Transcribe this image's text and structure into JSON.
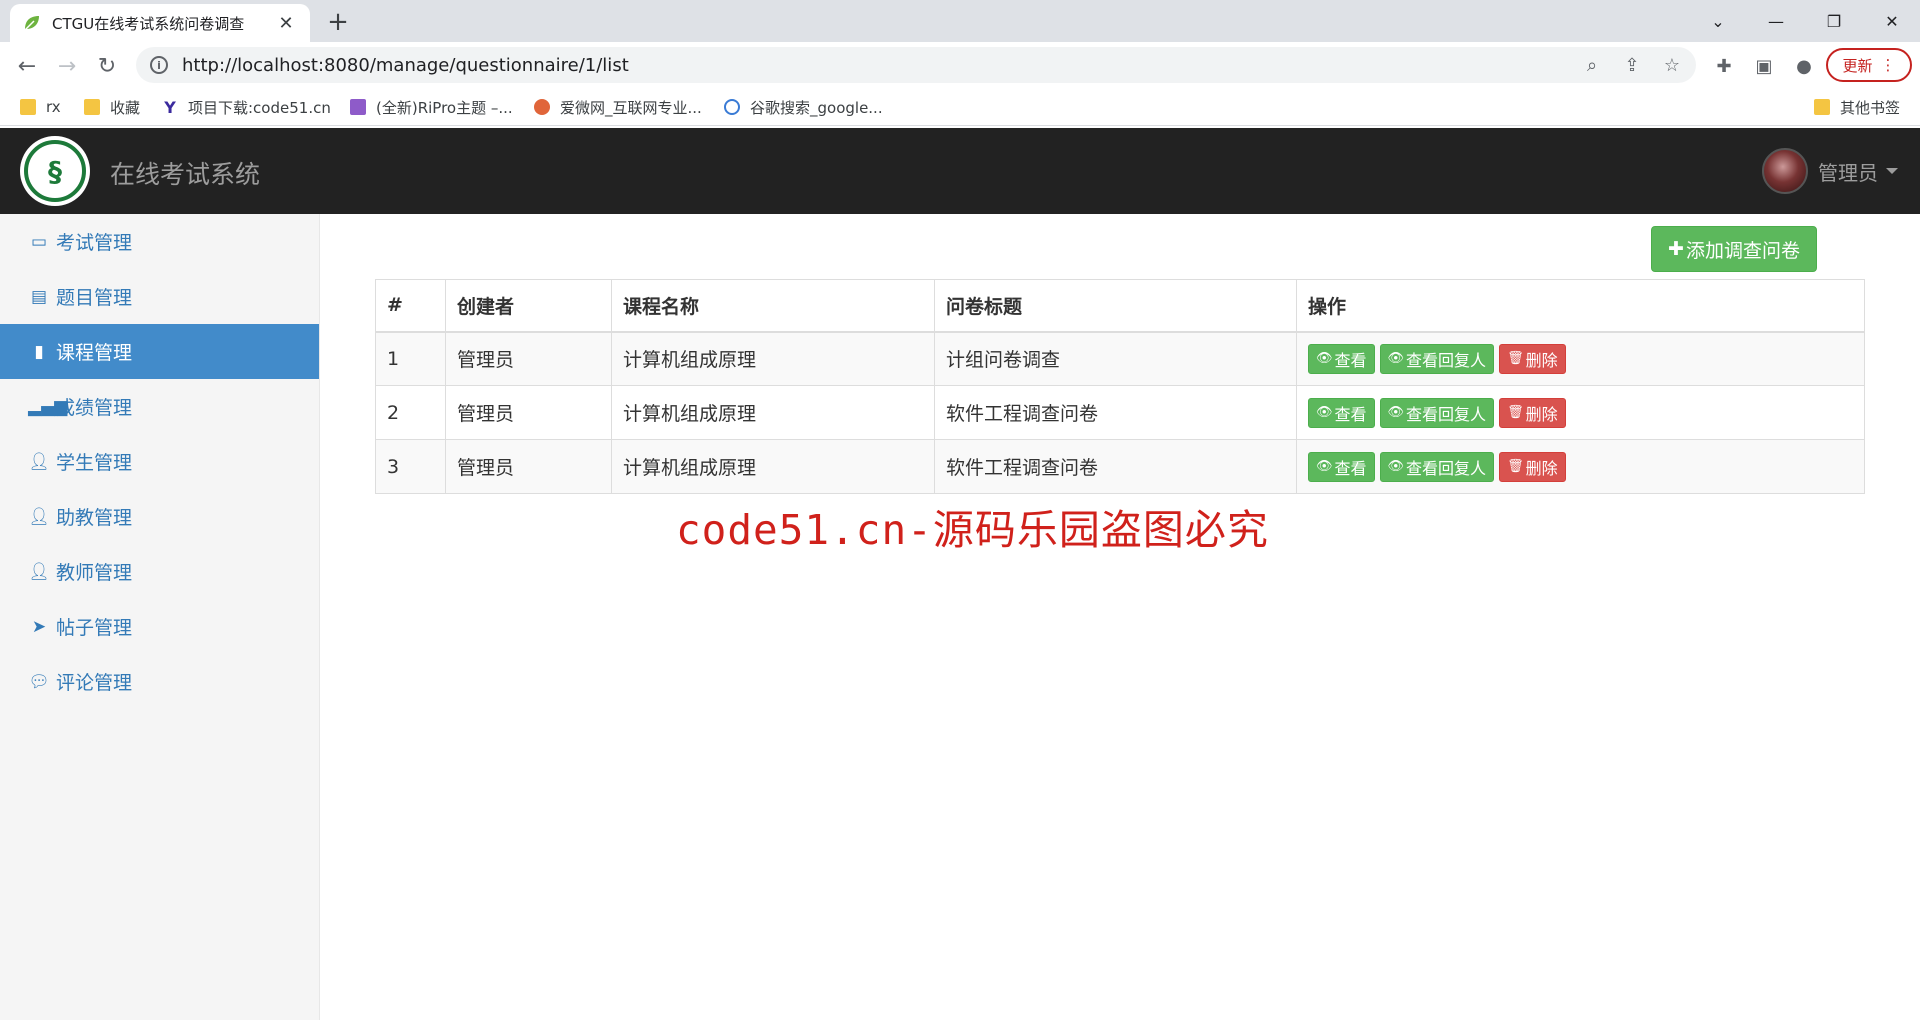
{
  "browser": {
    "tab_title": "CTGU在线考试系统问卷调查",
    "tab_close": "✕",
    "new_tab": "+",
    "url": "http://localhost:8080/manage/questionnaire/1/list",
    "update_label": "更新",
    "bookmarks": [
      {
        "label": "rx"
      },
      {
        "label": "收藏"
      },
      {
        "label": "项目下载:code51.cn"
      },
      {
        "label": "(全新)RiPro主题 –..."
      },
      {
        "label": "爱微网_互联网专业..."
      },
      {
        "label": "谷歌搜索_google..."
      }
    ],
    "other_bookmarks": "其他书签"
  },
  "app": {
    "brand": "在线考试系统",
    "user_name": "管理员",
    "sidebar": [
      {
        "label": "考试管理",
        "icon": "monitor-icon"
      },
      {
        "label": "题目管理",
        "icon": "list-icon"
      },
      {
        "label": "课程管理",
        "icon": "book-icon",
        "active": true
      },
      {
        "label": "成绩管理",
        "icon": "signal-icon"
      },
      {
        "label": "学生管理",
        "icon": "user-icon"
      },
      {
        "label": "助教管理",
        "icon": "user-icon"
      },
      {
        "label": "教师管理",
        "icon": "user-icon"
      },
      {
        "label": "帖子管理",
        "icon": "send-icon"
      },
      {
        "label": "评论管理",
        "icon": "comment-icon"
      }
    ],
    "add_button": "添加调查问卷",
    "table": {
      "headers": [
        "#",
        "创建者",
        "课程名称",
        "问卷标题",
        "操作"
      ],
      "rows": [
        {
          "id": "1",
          "creator": "管理员",
          "course": "计算机组成原理",
          "title": "计组问卷调查"
        },
        {
          "id": "2",
          "creator": "管理员",
          "course": "计算机组成原理",
          "title": "软件工程调查问卷"
        },
        {
          "id": "3",
          "creator": "管理员",
          "course": "计算机组成原理",
          "title": "软件工程调查问卷"
        }
      ],
      "actions": {
        "view": "查看",
        "view_responders": "查看回复人",
        "delete": "删除"
      }
    },
    "watermark": "code51.cn-源码乐园盗图必究"
  },
  "colors": {
    "success": "#5cb85c",
    "danger": "#d9534f",
    "active_nav": "#428bca",
    "header": "#222222"
  }
}
